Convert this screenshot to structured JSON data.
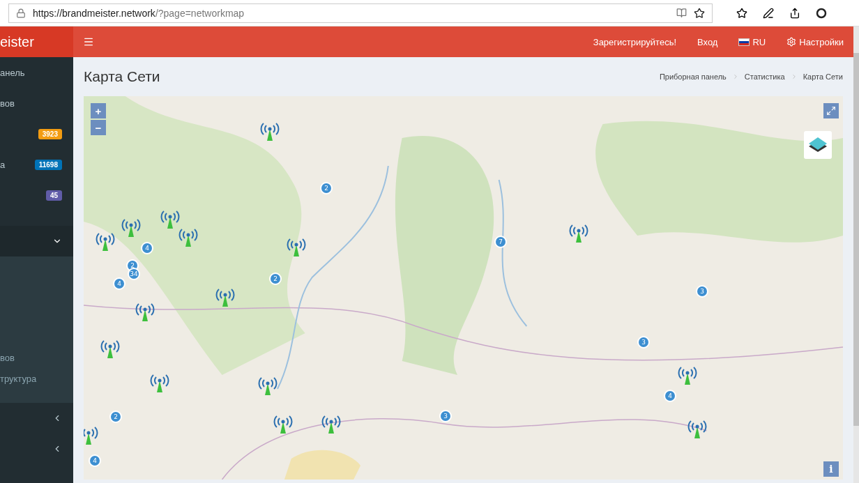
{
  "browser": {
    "url_host": "https://brandmeister.network",
    "url_path": "/?page=networkmap"
  },
  "header": {
    "logo": "eister",
    "links": [
      {
        "kind": "text",
        "label": "Зарегистрируйтесь!"
      },
      {
        "kind": "text",
        "label": "Вход"
      },
      {
        "kind": "flag",
        "label": "RU"
      },
      {
        "kind": "gear",
        "label": "Настройки"
      }
    ]
  },
  "sidebar": {
    "items": [
      {
        "label": "анель",
        "kind": "item"
      },
      {
        "label": "вов",
        "kind": "item"
      },
      {
        "kind": "badge",
        "badge": "3923",
        "color": "#f39c12"
      },
      {
        "label": "а",
        "kind": "badge",
        "badge": "11698",
        "color": "#0073b7"
      },
      {
        "kind": "badge",
        "badge": "45",
        "color": "#605ca8"
      },
      {
        "kind": "spacer"
      },
      {
        "kind": "section",
        "expanded": true,
        "children": [
          {
            "label": "вов"
          },
          {
            "label": "труктура"
          }
        ]
      },
      {
        "kind": "section",
        "expanded": false
      },
      {
        "kind": "section",
        "expanded": false
      }
    ]
  },
  "page": {
    "title": "Карта Сети",
    "breadcrumbs": [
      "Приборная панель",
      "Статистика",
      "Карта Сети"
    ]
  },
  "map": {
    "zoom_in": "+",
    "zoom_out": "−",
    "info": "i",
    "clusters": [
      "2",
      "7",
      "4",
      "2",
      "34",
      "2",
      "4",
      "3",
      "3",
      "4",
      "3",
      "2",
      "4"
    ]
  }
}
